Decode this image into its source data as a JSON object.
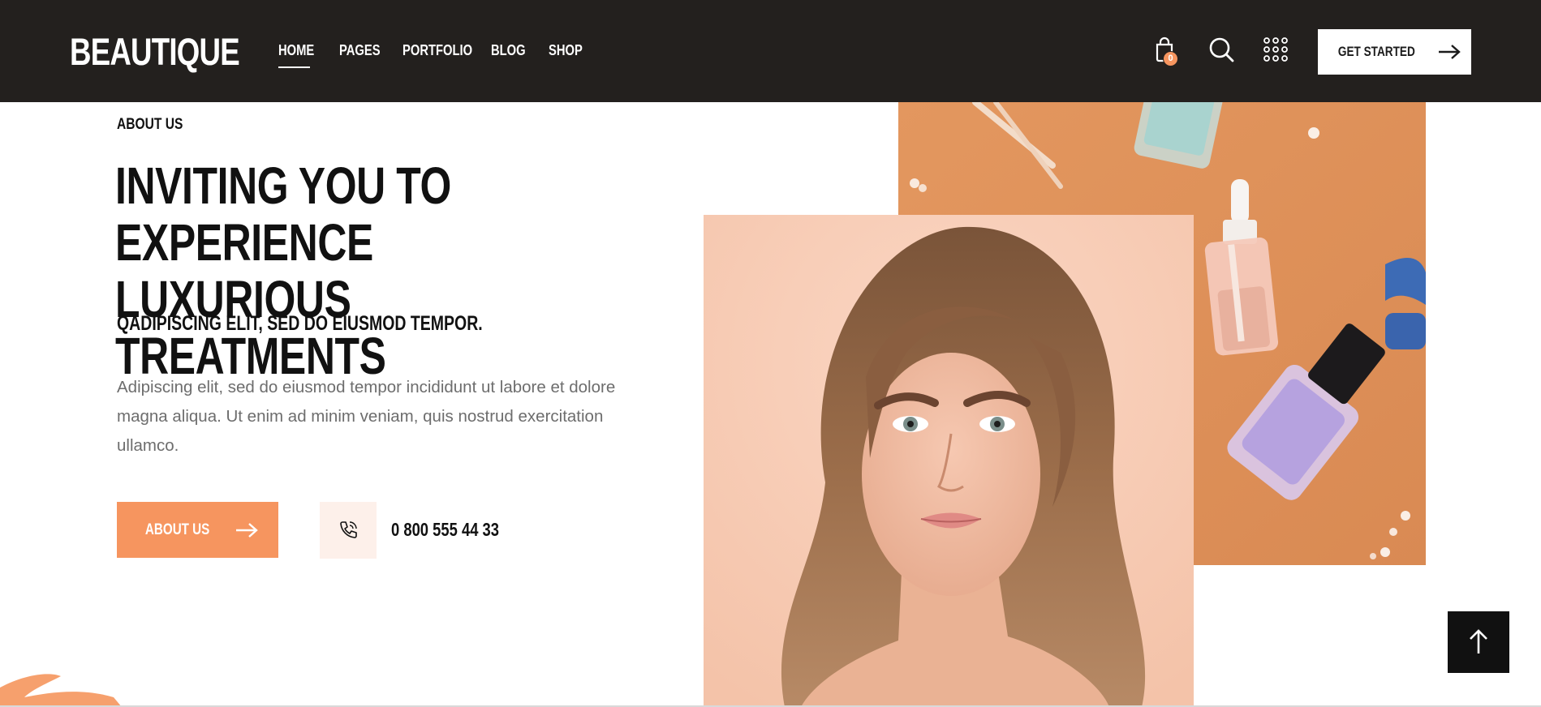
{
  "brand": {
    "logo": "BEAUTIQUE"
  },
  "nav": {
    "items": [
      {
        "label": "HOME",
        "active": true
      },
      {
        "label": "PAGES",
        "active": false
      },
      {
        "label": "PORTFOLIO",
        "active": false
      },
      {
        "label": "BLOG",
        "active": false
      },
      {
        "label": "SHOP",
        "active": false
      }
    ]
  },
  "header": {
    "cart_count": "0",
    "icons": [
      "cart-icon",
      "search-icon",
      "grid-menu-icon"
    ],
    "cta_label": "GET STARTED"
  },
  "hero": {
    "eyebrow": "ABOUT US",
    "title_line1": "INVITING YOU TO EXPERIENCE",
    "title_line2": "LUXURIOUS TREATMENTS",
    "subtitle": "QADIPISCING ELIT, SED DO EIUSMOD TEMPOR.",
    "paragraph": "Adipiscing elit, sed do eiusmod tempor incididunt ut labore et dolore magna aliqua. Ut enim ad minim veniam, quis nostrud exercitation ullamco.",
    "button_label": "ABOUT US",
    "phone": "0 800 555 44 33"
  },
  "colors": {
    "header_bg": "#23201e",
    "accent": "#f6955f",
    "text_dark": "#111111",
    "text_muted": "#6d6d6d",
    "phone_box_bg": "#fdf0ea"
  }
}
